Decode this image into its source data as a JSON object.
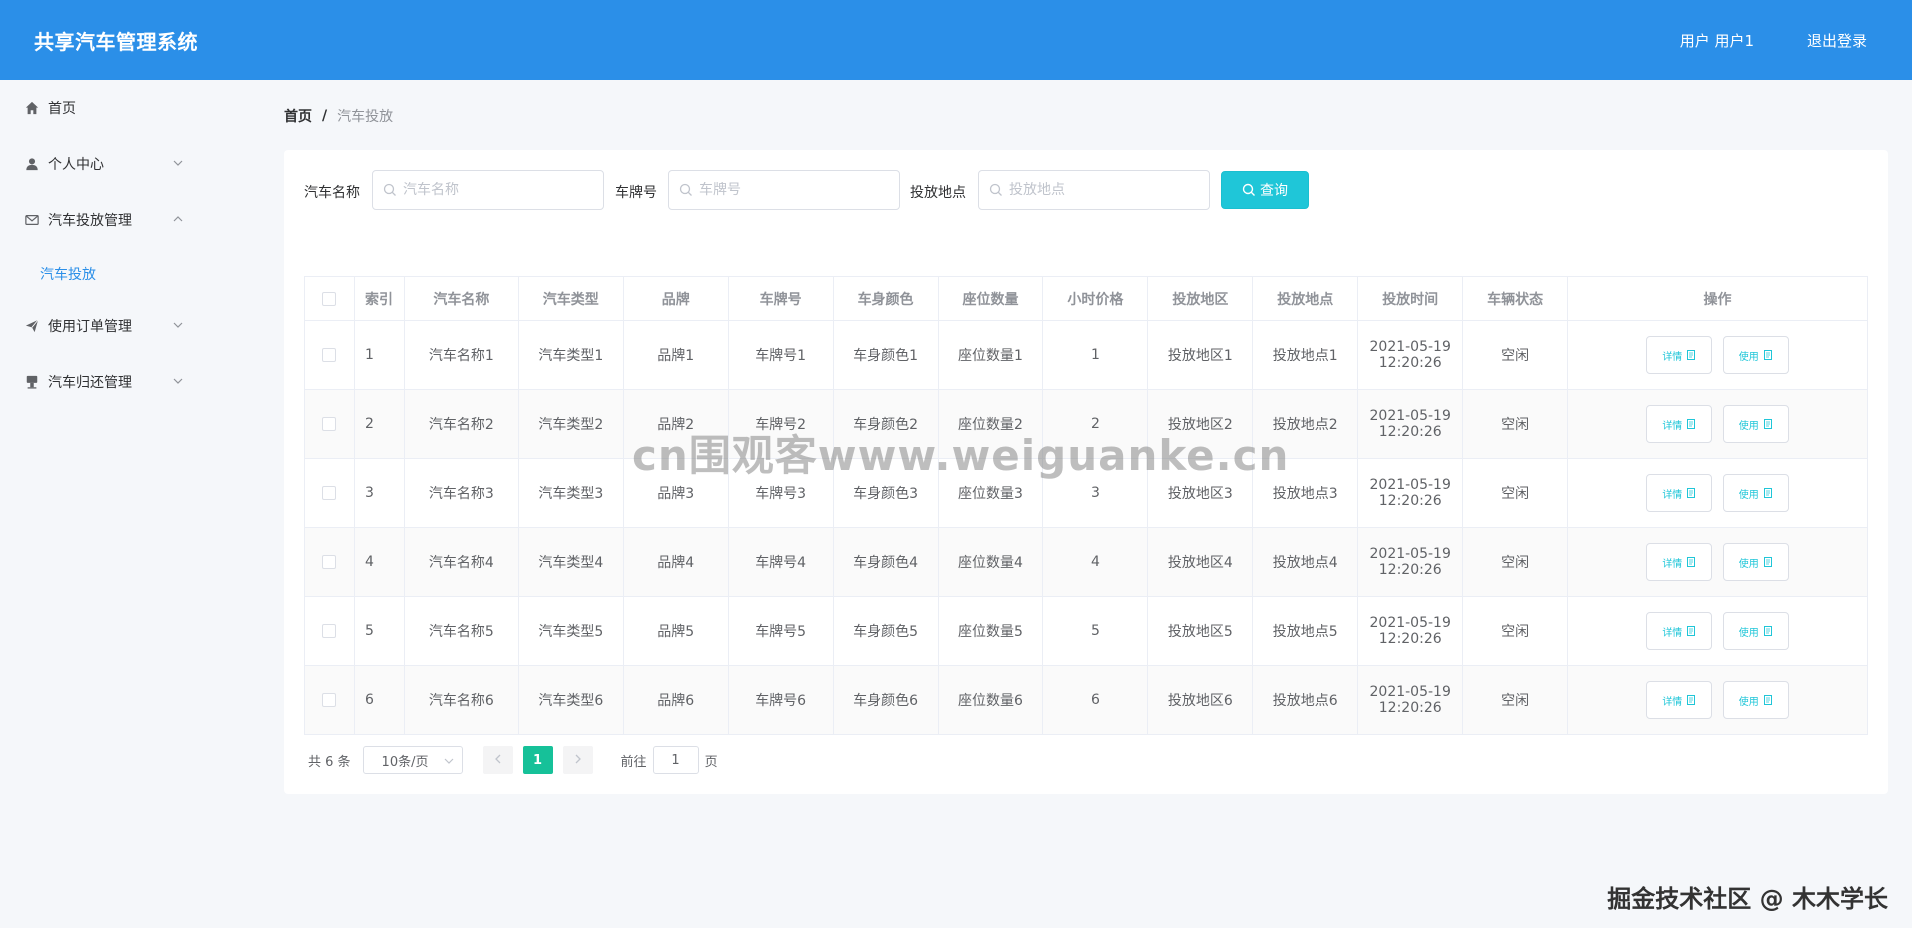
{
  "header": {
    "title": "共享汽车管理系统",
    "user": "用户 用户1",
    "logout": "退出登录"
  },
  "sidebar": {
    "items": [
      {
        "label": "首页",
        "icon": "home-icon"
      },
      {
        "label": "个人中心",
        "icon": "user-icon",
        "expanded": false
      },
      {
        "label": "汽车投放管理",
        "icon": "mail-icon",
        "expanded": true
      },
      {
        "label": "使用订单管理",
        "icon": "send-icon",
        "expanded": false
      },
      {
        "label": "汽车归还管理",
        "icon": "stamp-icon",
        "expanded": false
      }
    ],
    "submenu_active": "汽车投放"
  },
  "breadcrumb": {
    "home": "首页",
    "separator": "/",
    "current": "汽车投放"
  },
  "search": {
    "car_name_label": "汽车名称",
    "car_name_placeholder": "汽车名称",
    "plate_label": "车牌号",
    "plate_placeholder": "车牌号",
    "location_label": "投放地点",
    "location_placeholder": "投放地点",
    "query_button": "查询"
  },
  "table": {
    "headers": [
      "索引",
      "汽车名称",
      "汽车类型",
      "品牌",
      "车牌号",
      "车身颜色",
      "座位数量",
      "小时价格",
      "投放地区",
      "投放地点",
      "投放时间",
      "车辆状态",
      "操作"
    ],
    "detail_button": "详情",
    "use_button": "使用",
    "rows": [
      {
        "index": "1",
        "name": "汽车名称1",
        "type": "汽车类型1",
        "brand": "品牌1",
        "plate": "车牌号1",
        "color": "车身颜色1",
        "seats": "座位数量1",
        "price": "1",
        "region": "投放地区1",
        "location": "投放地点1",
        "date": "2021-05-19",
        "time": "12:20:26",
        "status": "空闲"
      },
      {
        "index": "2",
        "name": "汽车名称2",
        "type": "汽车类型2",
        "brand": "品牌2",
        "plate": "车牌号2",
        "color": "车身颜色2",
        "seats": "座位数量2",
        "price": "2",
        "region": "投放地区2",
        "location": "投放地点2",
        "date": "2021-05-19",
        "time": "12:20:26",
        "status": "空闲"
      },
      {
        "index": "3",
        "name": "汽车名称3",
        "type": "汽车类型3",
        "brand": "品牌3",
        "plate": "车牌号3",
        "color": "车身颜色3",
        "seats": "座位数量3",
        "price": "3",
        "region": "投放地区3",
        "location": "投放地点3",
        "date": "2021-05-19",
        "time": "12:20:26",
        "status": "空闲"
      },
      {
        "index": "4",
        "name": "汽车名称4",
        "type": "汽车类型4",
        "brand": "品牌4",
        "plate": "车牌号4",
        "color": "车身颜色4",
        "seats": "座位数量4",
        "price": "4",
        "region": "投放地区4",
        "location": "投放地点4",
        "date": "2021-05-19",
        "time": "12:20:26",
        "status": "空闲"
      },
      {
        "index": "5",
        "name": "汽车名称5",
        "type": "汽车类型5",
        "brand": "品牌5",
        "plate": "车牌号5",
        "color": "车身颜色5",
        "seats": "座位数量5",
        "price": "5",
        "region": "投放地区5",
        "location": "投放地点5",
        "date": "2021-05-19",
        "time": "12:20:26",
        "status": "空闲"
      },
      {
        "index": "6",
        "name": "汽车名称6",
        "type": "汽车类型6",
        "brand": "品牌6",
        "plate": "车牌号6",
        "color": "车身颜色6",
        "seats": "座位数量6",
        "price": "6",
        "region": "投放地区6",
        "location": "投放地点6",
        "date": "2021-05-19",
        "time": "12:20:26",
        "status": "空闲"
      }
    ]
  },
  "pagination": {
    "total": "共 6 条",
    "page_size": "10条/页",
    "current_page": "1",
    "goto_prefix": "前往",
    "goto_value": "1",
    "goto_suffix": "页"
  },
  "watermark": "cn围观客www.weiguanke.cn",
  "corner_mark": "掘金技术社区 @ 木木学长",
  "colors": {
    "header": "#2b8fe8",
    "accent": "#1fc6d8",
    "page_active": "#16c199"
  }
}
